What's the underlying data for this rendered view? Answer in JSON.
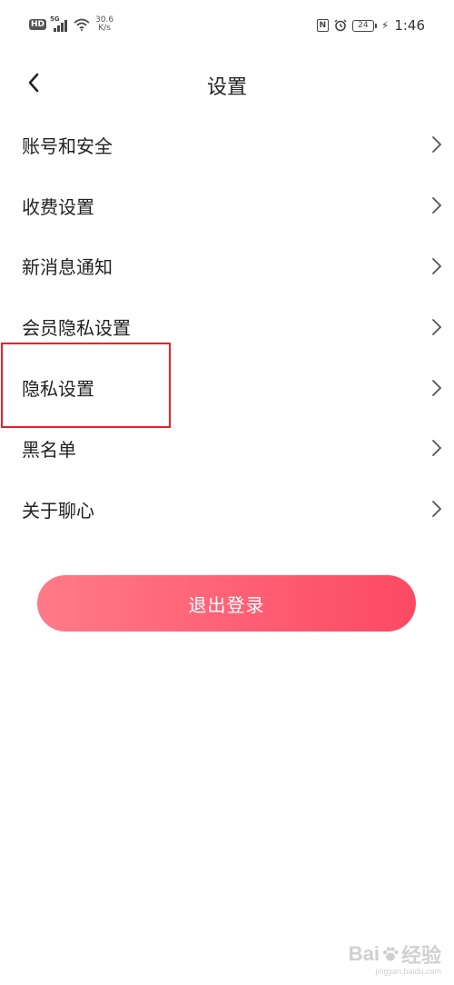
{
  "status_bar": {
    "hd_badge": "HD",
    "network": "5G",
    "speed_value": "30.6",
    "speed_unit": "K/s",
    "nfc": "N",
    "battery": "24",
    "time": "1:46"
  },
  "nav": {
    "title": "设置"
  },
  "settings": {
    "items": [
      {
        "label": "账号和安全"
      },
      {
        "label": "收费设置"
      },
      {
        "label": "新消息通知"
      },
      {
        "label": "会员隐私设置"
      },
      {
        "label": "隐私设置"
      },
      {
        "label": "黑名单"
      },
      {
        "label": "关于聊心"
      }
    ]
  },
  "logout": {
    "label": "退出登录"
  },
  "watermark": {
    "brand_left": "Bai",
    "brand_right": "经验",
    "url": "jingyan.baidu.com"
  },
  "colors": {
    "logout_gradient_start": "#ff7a88",
    "logout_gradient_end": "#fb4a62",
    "highlight_border": "#e8202a",
    "text_primary": "#222222",
    "chevron": "#555555"
  }
}
